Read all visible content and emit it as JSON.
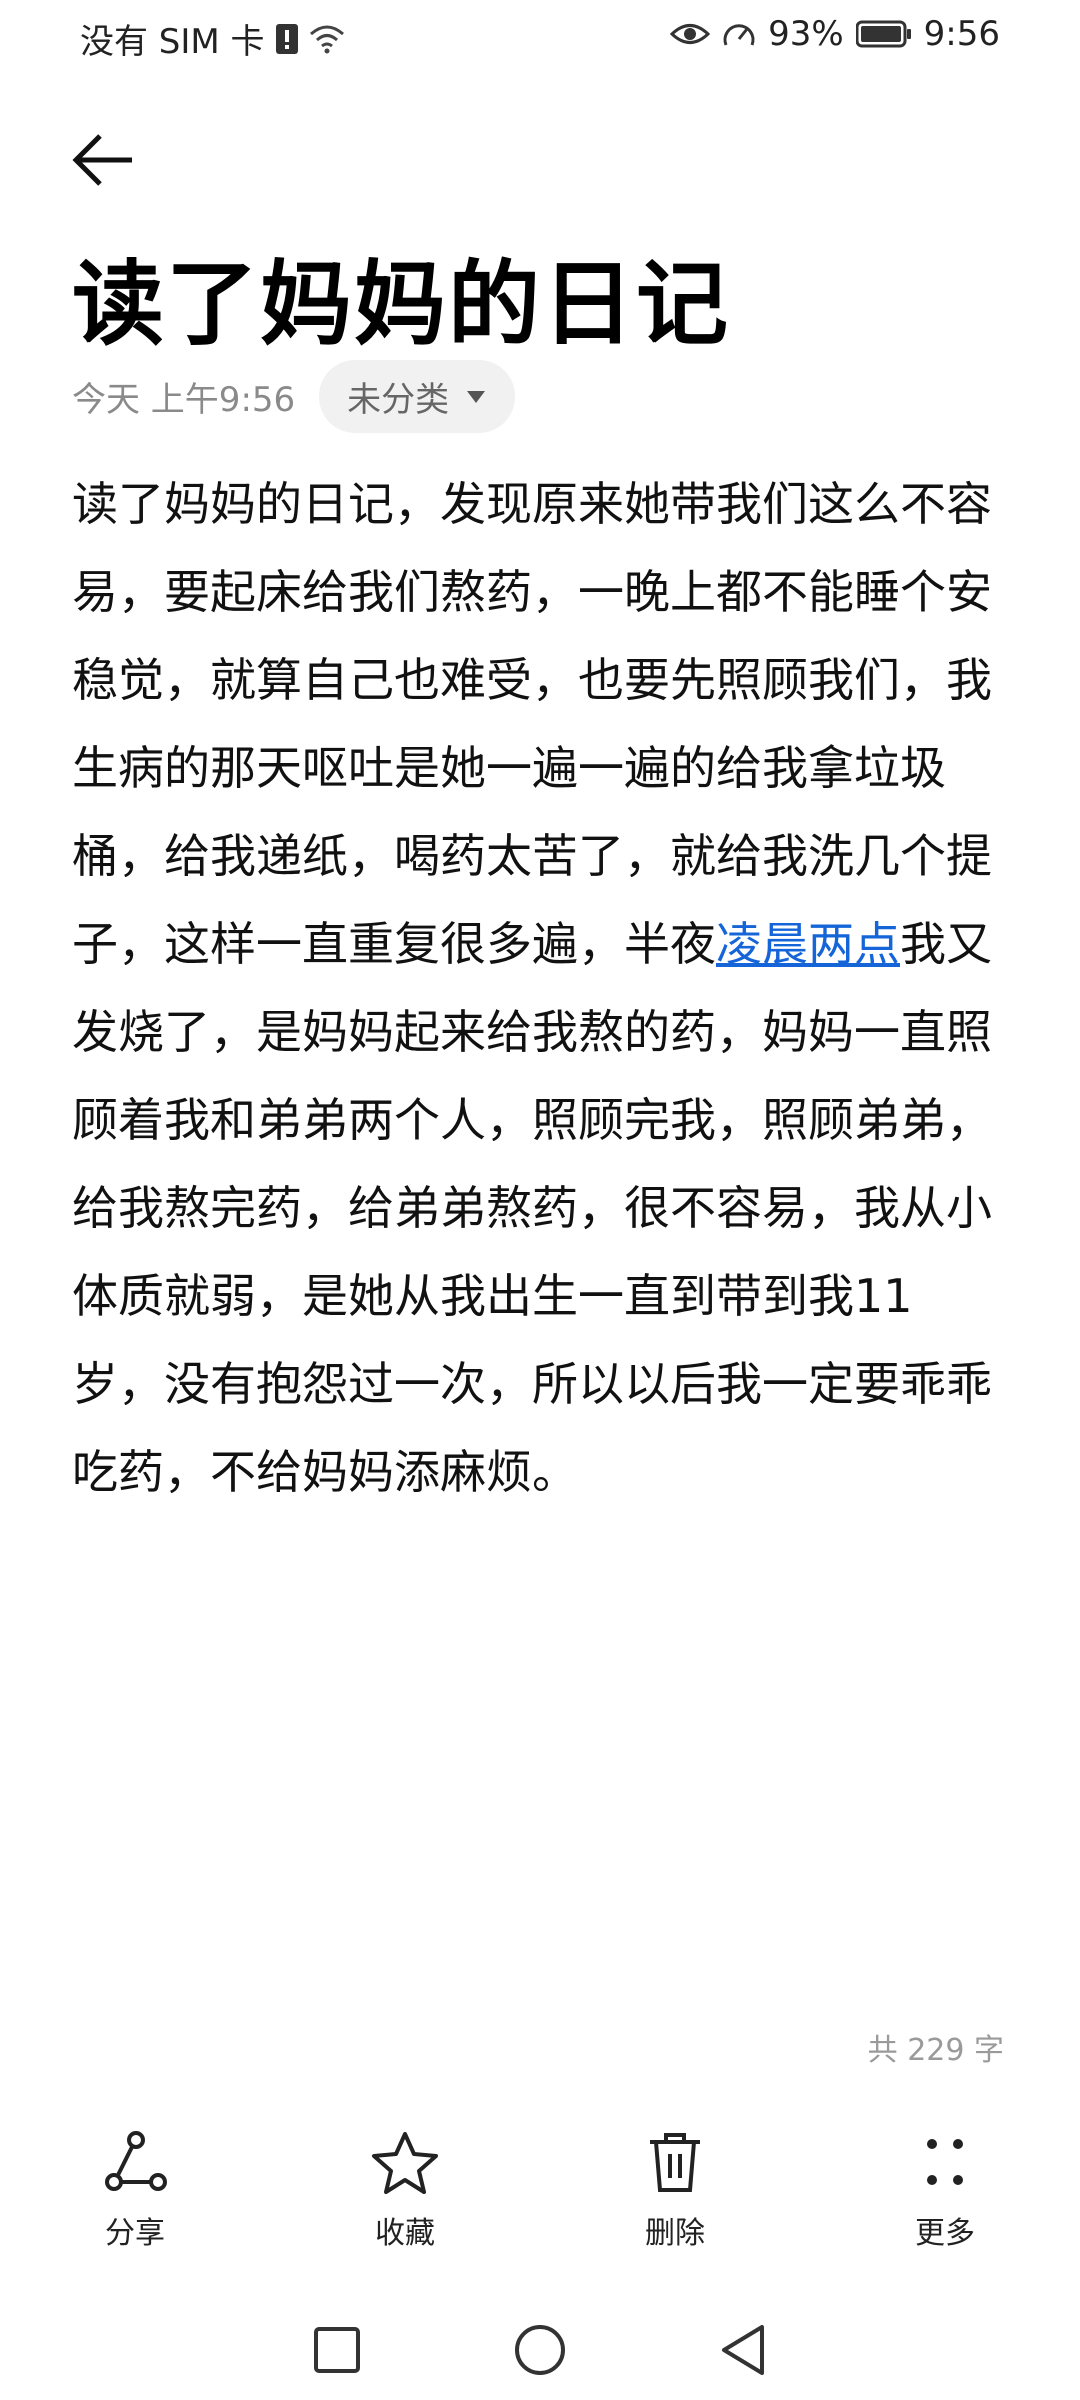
{
  "status_bar": {
    "carrier": "没有 SIM 卡",
    "battery_percent": "93%",
    "time": "9:56"
  },
  "note": {
    "title": "读了妈妈的日记",
    "date": "今天 上午9:56",
    "category": "未分类",
    "body_before_link": "读了妈妈的日记，发现原来她带我们这么不容易，要起床给我们熬药，一晚上都不能睡个安稳觉，就算自己也难受，也要先照顾我们，我生病的那天呕吐是她一遍一遍的给我拿垃圾桶，给我递纸，喝药太苦了，就给我洗几个提子，这样一直重复很多遍，半夜",
    "body_link": "凌晨两点",
    "body_after_link": "我又发烧了，是妈妈起来给我熬的药，妈妈一直照顾着我和弟弟两个人，照顾完我，照顾弟弟，给我熬完药，给弟弟熬药，很不容易，我从小体质就弱，是她从我出生一直到带到我11岁，没有抱怨过一次，所以以后我一定要乖乖吃药，不给妈妈添麻烦。",
    "word_count": "共 229 字"
  },
  "toolbar": {
    "share": "分享",
    "favorite": "收藏",
    "delete": "删除",
    "more": "更多"
  }
}
